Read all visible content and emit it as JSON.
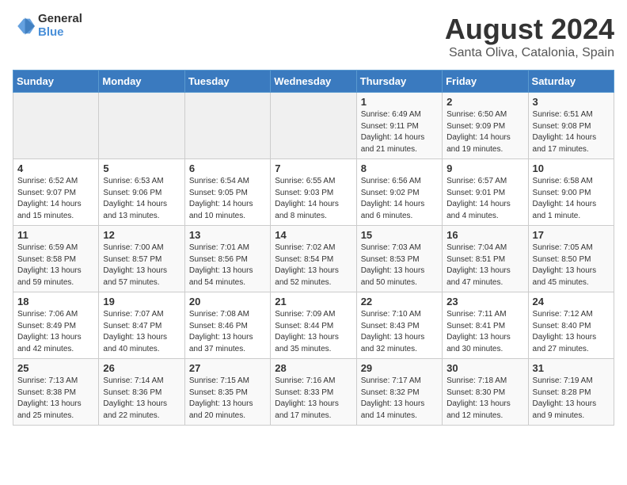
{
  "header": {
    "logo_general": "General",
    "logo_blue": "Blue",
    "month": "August 2024",
    "location": "Santa Oliva, Catalonia, Spain"
  },
  "weekdays": [
    "Sunday",
    "Monday",
    "Tuesday",
    "Wednesday",
    "Thursday",
    "Friday",
    "Saturday"
  ],
  "weeks": [
    [
      {
        "day": "",
        "info": ""
      },
      {
        "day": "",
        "info": ""
      },
      {
        "day": "",
        "info": ""
      },
      {
        "day": "",
        "info": ""
      },
      {
        "day": "1",
        "info": "Sunrise: 6:49 AM\nSunset: 9:11 PM\nDaylight: 14 hours\nand 21 minutes."
      },
      {
        "day": "2",
        "info": "Sunrise: 6:50 AM\nSunset: 9:09 PM\nDaylight: 14 hours\nand 19 minutes."
      },
      {
        "day": "3",
        "info": "Sunrise: 6:51 AM\nSunset: 9:08 PM\nDaylight: 14 hours\nand 17 minutes."
      }
    ],
    [
      {
        "day": "4",
        "info": "Sunrise: 6:52 AM\nSunset: 9:07 PM\nDaylight: 14 hours\nand 15 minutes."
      },
      {
        "day": "5",
        "info": "Sunrise: 6:53 AM\nSunset: 9:06 PM\nDaylight: 14 hours\nand 13 minutes."
      },
      {
        "day": "6",
        "info": "Sunrise: 6:54 AM\nSunset: 9:05 PM\nDaylight: 14 hours\nand 10 minutes."
      },
      {
        "day": "7",
        "info": "Sunrise: 6:55 AM\nSunset: 9:03 PM\nDaylight: 14 hours\nand 8 minutes."
      },
      {
        "day": "8",
        "info": "Sunrise: 6:56 AM\nSunset: 9:02 PM\nDaylight: 14 hours\nand 6 minutes."
      },
      {
        "day": "9",
        "info": "Sunrise: 6:57 AM\nSunset: 9:01 PM\nDaylight: 14 hours\nand 4 minutes."
      },
      {
        "day": "10",
        "info": "Sunrise: 6:58 AM\nSunset: 9:00 PM\nDaylight: 14 hours\nand 1 minute."
      }
    ],
    [
      {
        "day": "11",
        "info": "Sunrise: 6:59 AM\nSunset: 8:58 PM\nDaylight: 13 hours\nand 59 minutes."
      },
      {
        "day": "12",
        "info": "Sunrise: 7:00 AM\nSunset: 8:57 PM\nDaylight: 13 hours\nand 57 minutes."
      },
      {
        "day": "13",
        "info": "Sunrise: 7:01 AM\nSunset: 8:56 PM\nDaylight: 13 hours\nand 54 minutes."
      },
      {
        "day": "14",
        "info": "Sunrise: 7:02 AM\nSunset: 8:54 PM\nDaylight: 13 hours\nand 52 minutes."
      },
      {
        "day": "15",
        "info": "Sunrise: 7:03 AM\nSunset: 8:53 PM\nDaylight: 13 hours\nand 50 minutes."
      },
      {
        "day": "16",
        "info": "Sunrise: 7:04 AM\nSunset: 8:51 PM\nDaylight: 13 hours\nand 47 minutes."
      },
      {
        "day": "17",
        "info": "Sunrise: 7:05 AM\nSunset: 8:50 PM\nDaylight: 13 hours\nand 45 minutes."
      }
    ],
    [
      {
        "day": "18",
        "info": "Sunrise: 7:06 AM\nSunset: 8:49 PM\nDaylight: 13 hours\nand 42 minutes."
      },
      {
        "day": "19",
        "info": "Sunrise: 7:07 AM\nSunset: 8:47 PM\nDaylight: 13 hours\nand 40 minutes."
      },
      {
        "day": "20",
        "info": "Sunrise: 7:08 AM\nSunset: 8:46 PM\nDaylight: 13 hours\nand 37 minutes."
      },
      {
        "day": "21",
        "info": "Sunrise: 7:09 AM\nSunset: 8:44 PM\nDaylight: 13 hours\nand 35 minutes."
      },
      {
        "day": "22",
        "info": "Sunrise: 7:10 AM\nSunset: 8:43 PM\nDaylight: 13 hours\nand 32 minutes."
      },
      {
        "day": "23",
        "info": "Sunrise: 7:11 AM\nSunset: 8:41 PM\nDaylight: 13 hours\nand 30 minutes."
      },
      {
        "day": "24",
        "info": "Sunrise: 7:12 AM\nSunset: 8:40 PM\nDaylight: 13 hours\nand 27 minutes."
      }
    ],
    [
      {
        "day": "25",
        "info": "Sunrise: 7:13 AM\nSunset: 8:38 PM\nDaylight: 13 hours\nand 25 minutes."
      },
      {
        "day": "26",
        "info": "Sunrise: 7:14 AM\nSunset: 8:36 PM\nDaylight: 13 hours\nand 22 minutes."
      },
      {
        "day": "27",
        "info": "Sunrise: 7:15 AM\nSunset: 8:35 PM\nDaylight: 13 hours\nand 20 minutes."
      },
      {
        "day": "28",
        "info": "Sunrise: 7:16 AM\nSunset: 8:33 PM\nDaylight: 13 hours\nand 17 minutes."
      },
      {
        "day": "29",
        "info": "Sunrise: 7:17 AM\nSunset: 8:32 PM\nDaylight: 13 hours\nand 14 minutes."
      },
      {
        "day": "30",
        "info": "Sunrise: 7:18 AM\nSunset: 8:30 PM\nDaylight: 13 hours\nand 12 minutes."
      },
      {
        "day": "31",
        "info": "Sunrise: 7:19 AM\nSunset: 8:28 PM\nDaylight: 13 hours\nand 9 minutes."
      }
    ]
  ]
}
